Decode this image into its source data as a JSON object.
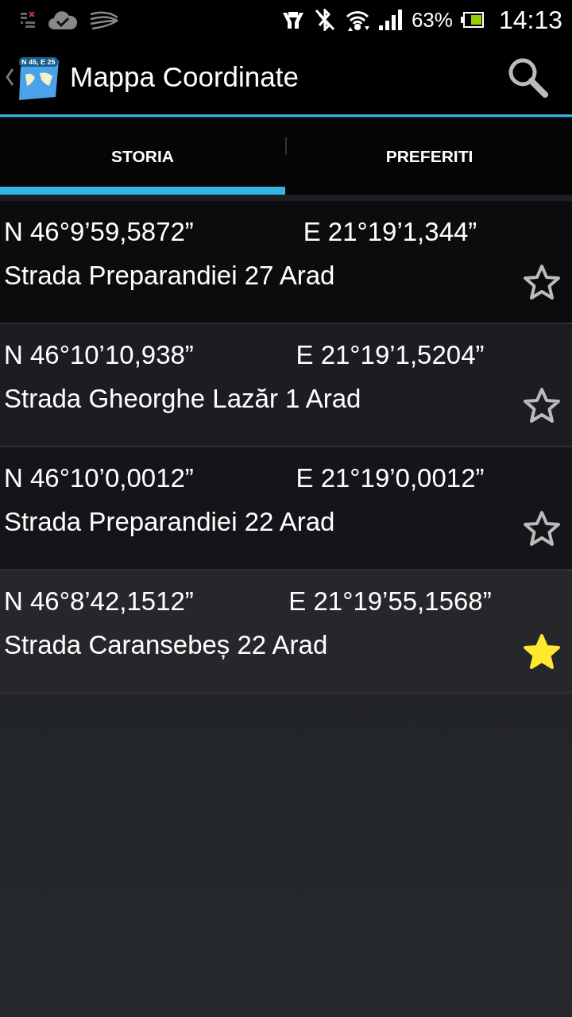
{
  "status_bar": {
    "battery": "63%",
    "time": "14:13"
  },
  "action_bar": {
    "app_icon_label": "N 45, E 25",
    "title": "Mappa Coordinate"
  },
  "tabs": [
    {
      "label": "STORIA",
      "selected": true
    },
    {
      "label": "PREFERITI",
      "selected": false
    }
  ],
  "rows": [
    {
      "latitude": "N 46°9’59,5872”",
      "longitude": "E 21°19’1,344”",
      "address": "Strada Preparandiei 27 Arad",
      "favorite": false
    },
    {
      "latitude": "N 46°10’10,938”",
      "longitude": "E 21°19’1,5204”",
      "address": "Strada Gheorghe Lazăr 1 Arad",
      "favorite": false
    },
    {
      "latitude": "N 46°10’0,0012”",
      "longitude": "E 21°19’0,0012”",
      "address": "Strada Preparandiei 22 Arad",
      "favorite": false
    },
    {
      "latitude": "N 46°8’42,1512”",
      "longitude": "E 21°19’55,1568”",
      "address": "Strada Caransebeș 22 Arad",
      "favorite": true
    }
  ]
}
